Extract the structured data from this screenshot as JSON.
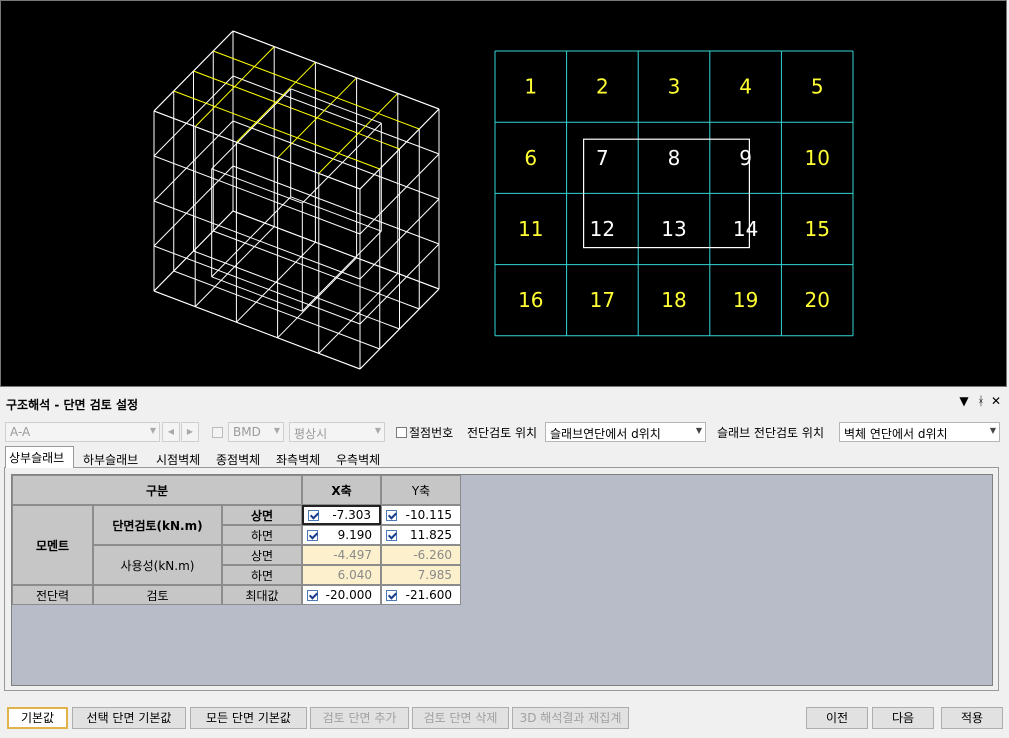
{
  "viewport": {
    "grid_cells": [
      "1",
      "2",
      "3",
      "4",
      "5",
      "6",
      "7",
      "8",
      "9",
      "10",
      "11",
      "12",
      "13",
      "14",
      "15",
      "16",
      "17",
      "18",
      "19",
      "20"
    ],
    "colors": {
      "background": "#000000",
      "grid_line": "#33d6d6",
      "label_yellow": "#ffff33",
      "label_white": "#ffffff",
      "wire": "#ffffff",
      "wire_accent": "#ffff00"
    }
  },
  "panel": {
    "title": "구조해석 - 단면 검토 설정",
    "controls": {
      "dropdown": "▼",
      "pin": "ᚼ",
      "close": "✕"
    }
  },
  "toolbar": {
    "section_combo": "A-A",
    "prev_glyph": "◀",
    "next_glyph": "▶",
    "bmd_combo": "BMD",
    "state_combo": "평상시",
    "node_number_label": "절점번호",
    "shear_check_label": "전단검토 위치",
    "shear_check_value": "슬래브연단에서 d위치",
    "slab_shear_label": "슬래브 전단검토 위치",
    "slab_shear_value": "벽체 연단에서 d위치"
  },
  "tabs": [
    "상부슬래브",
    "하부슬래브",
    "시점벽체",
    "종점벽체",
    "좌측벽체",
    "우측벽체"
  ],
  "table": {
    "header": {
      "category": "구분",
      "x_axis": "X축",
      "y_axis": "Y축"
    },
    "moment": "모멘트",
    "section_check": "단면검토(kN.m)",
    "serviceability": "사용성(kN.m)",
    "shear": "전단력",
    "check": "검토",
    "rows": [
      {
        "label": "상면",
        "x": "-7.303",
        "y": "-10.115"
      },
      {
        "label": "하면",
        "x": "9.190",
        "y": "11.825"
      },
      {
        "label": "상면",
        "x": "-4.497",
        "y": "-6.260"
      },
      {
        "label": "하면",
        "x": "6.040",
        "y": "7.985"
      },
      {
        "label": "최대값",
        "x": "-20.000",
        "y": "-21.600"
      }
    ]
  },
  "buttons": {
    "default": "기본값",
    "selected_default": "선택 단면 기본값",
    "all_default": "모든 단면 기본값",
    "add_section": "검토 단면 추가",
    "delete_section": "검토 단면 삭제",
    "recompute_3d": "3D 해석결과 재집계",
    "prev": "이전",
    "next": "다음",
    "apply": "적용"
  }
}
